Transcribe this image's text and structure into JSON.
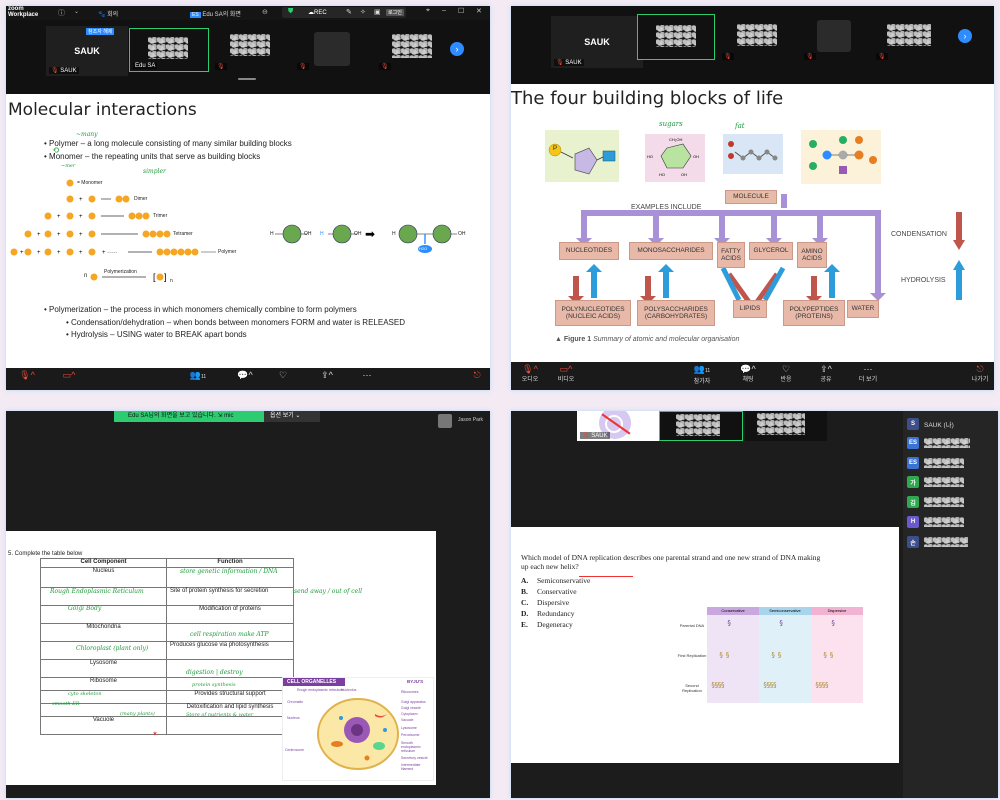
{
  "app": {
    "name": "zoom\nWorkplace"
  },
  "p1": {
    "topbar": {
      "menu_label": "회의",
      "tab_label": "Edu SA의 화면",
      "rec_label": "REC",
      "other_label": "로그인"
    },
    "tiles": [
      {
        "name": "SAUK",
        "label": "SAUK"
      },
      {
        "name": "",
        "label": "Edu SA",
        "badge": "참조자 해제"
      }
    ],
    "slide": {
      "title": "Molecular interactions",
      "bullets": [
        "Polymer – a long molecule consisting of many similar building blocks",
        "Monomer – the repeating units that serve as building blocks"
      ],
      "ink_many": "~many",
      "ink_simpler": "simpler",
      "ink_mer": "~mer",
      "series": [
        {
          "label": "= Monomer"
        },
        {
          "label": "Dimer"
        },
        {
          "label": "Trimer"
        },
        {
          "label": "Tetramer"
        },
        {
          "label": "Polymer"
        }
      ],
      "polymerization": "Polymerization",
      "n_label": "n",
      "reaction": {
        "h": "H",
        "oh": "OH",
        "water": "H2O"
      },
      "sub_bullets": [
        "Polymerization – the process in which monomers chemically combine to form polymers",
        "Condensation/dehydration – when bonds between monomers FORM and water is RELEASED",
        "Hydrolysis – USING water to BREAK apart bonds"
      ]
    },
    "toolbar": {
      "participants_count": "11"
    }
  },
  "p2": {
    "tiles": [
      {
        "name": "SAUK",
        "label": "SAUK"
      }
    ],
    "slide": {
      "title": "The four building blocks of life",
      "ink_sugars": "sugars",
      "ink_fat": "fat",
      "examples_include": "EXAMPLES INCLUDE",
      "molecule": "MOLECULE",
      "row1": [
        "NUCLEOTIDES",
        "MONOSACCHARIDES",
        "FATTY ACIDS",
        "GLYCEROL",
        "AMINO ACIDS"
      ],
      "row2": [
        "POLYNUCLEOTIDES (NUCLEIC ACIDS)",
        "POLYSACCHARIDES (CARBOHYDRATES)",
        "LIPIDS",
        "POLYPEPTIDES (PROTEINS)",
        "WATER"
      ],
      "condensation": "CONDENSATION",
      "hydrolysis": "HYDROLYSIS",
      "figure_caption_bold": "▲ Figure 1",
      "figure_caption": "Summary of atomic and molecular organisation",
      "p_label": "P"
    },
    "toolbar": {
      "items": [
        "오디오",
        "비디오",
        "참가자",
        "채팅",
        "반응",
        "공유",
        "더 보기",
        "나가기"
      ],
      "participants_count": "11"
    }
  },
  "p3": {
    "banner": "Edu SA님의 화면을 보고 있습니다.",
    "banner_badge": "mic",
    "view_options": "옵션 보기",
    "participant": "Jason Park",
    "worksheet": {
      "question": "5.  Complete the table below",
      "headers": [
        "Cell Component",
        "Function"
      ],
      "rows": [
        [
          "Nucleus",
          ""
        ],
        [
          "",
          "Site of protein synthesis for secretion"
        ],
        [
          "",
          "Modification of proteins"
        ],
        [
          "Mitochondria",
          ""
        ],
        [
          "",
          "Produces glucose via photosynthesis"
        ],
        [
          "Lysosome",
          ""
        ],
        [
          "Ribosome",
          ""
        ],
        [
          "",
          "Provides structural support"
        ],
        [
          "",
          "Detoxification and lipid synthesis"
        ],
        [
          "Vacuole",
          ""
        ]
      ],
      "ink": {
        "nucleus": "store genetic information / DNA",
        "rough_er": "Rough Endoplasmic Reticulum",
        "golgi": "Golgi Body",
        "mito": "cell respiration make ATP",
        "chloro": "Chloroplast (plant only)",
        "lyso": "digestion | destroy",
        "ribo": "protein synthesis",
        "cytoskeleton": "cyto skeleton",
        "smooth_er": "smooth ER",
        "vacuole_left": "(many plants)",
        "vacuole_right": "Store of nutrients & water",
        "arrow_note": "send away / out of cell"
      },
      "organelles": {
        "title": "CELL ORGANELLES",
        "brand": "BYJU'S",
        "labels_left": [
          "Rough endoplasmic reticulum",
          "Chromatin",
          "Nucleus",
          "Centrosome"
        ],
        "labels_top": [
          "Nucleolus"
        ],
        "labels_right": [
          "Ribosomes",
          "Golgi apparatus",
          "Golgi vesicle",
          "Cytoplasm",
          "Vacuole",
          "Lysosome",
          "Peroxisome",
          "Smooth endoplasmic reticulum",
          "Secretory vesicle",
          "Intermediate filament"
        ]
      }
    }
  },
  "p4": {
    "tile_label": "SAUK",
    "question": "Which model of DNA replication describes one parental strand and one new strand of DNA making up each new helix?",
    "options": [
      {
        "letter": "A.",
        "text": "Semiconservative"
      },
      {
        "letter": "B.",
        "text": "Conservative"
      },
      {
        "letter": "C.",
        "text": "Dispersive"
      },
      {
        "letter": "D.",
        "text": "Redundancy"
      },
      {
        "letter": "E.",
        "text": "Degeneracy"
      }
    ],
    "figure": {
      "columns": [
        "Conservative",
        "Semiconservative",
        "Dispersive"
      ],
      "rows": [
        "Parental DNA",
        "First Replication",
        "Second Replication"
      ]
    },
    "sidebar": [
      {
        "avatar": "S",
        "name": "SAUK (나)",
        "color": "#3d4f8a"
      },
      {
        "avatar": "ES",
        "name": "",
        "color": "#3b73d4"
      },
      {
        "avatar": "ES",
        "name": "",
        "color": "#3b73d4"
      },
      {
        "avatar": "가",
        "name": "",
        "color": "#2fa84f"
      },
      {
        "avatar": "김",
        "name": "",
        "color": "#2fa84f"
      },
      {
        "avatar": "H",
        "name": "",
        "color": "#6a5acd"
      },
      {
        "avatar": "손",
        "name": "",
        "color": "#3d4f8a"
      }
    ]
  }
}
